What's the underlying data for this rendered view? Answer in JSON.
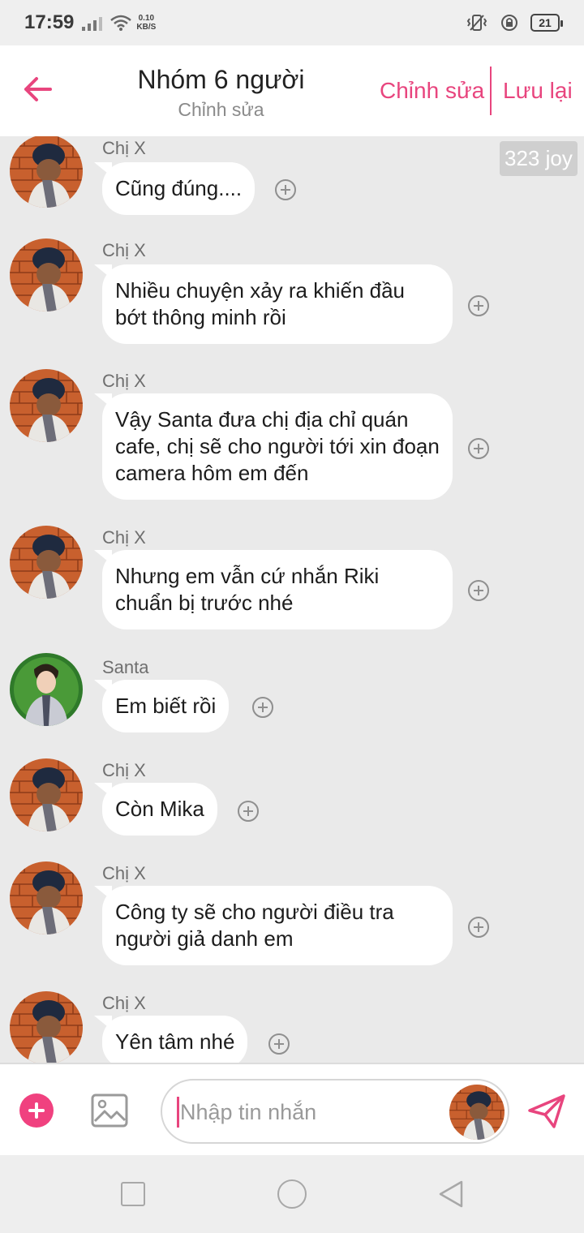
{
  "status_bar": {
    "time": "17:59",
    "net_speed_value": "0.10",
    "net_speed_unit": "KB/S",
    "battery": "21"
  },
  "header": {
    "back_icon": "arrow-left-icon",
    "title": "Nhóm 6 người",
    "subtitle": "Chỉnh sửa",
    "edit_label": "Chỉnh sửa",
    "save_label": "Lưu lại"
  },
  "overlay": {
    "badge": "323 joy"
  },
  "messages": [
    {
      "sender": "Chị X",
      "text": "Cũng đúng...."
    },
    {
      "sender": "Chị X",
      "text": "Nhiều chuyện xảy ra khiến đầu bớt thông minh rồi"
    },
    {
      "sender": "Chị X",
      "text": "Vậy Santa đưa chị địa chỉ quán cafe, chị sẽ cho người  tới xin đoạn camera hôm em đến"
    },
    {
      "sender": "Chị X",
      "text": "Nhưng em vẫn cứ nhắn Riki chuẩn bị trước nhé"
    },
    {
      "sender": "Santa",
      "text": "Em biết rồi"
    },
    {
      "sender": "Chị X",
      "text": "Còn Mika"
    },
    {
      "sender": "Chị X",
      "text": "Công ty sẽ cho người điều tra người giả danh em"
    },
    {
      "sender": "Chị X",
      "text": "Yên tâm nhé"
    }
  ],
  "composer": {
    "placeholder": "Nhập tin nhắn",
    "value": ""
  },
  "colors": {
    "accent": "#e8457e",
    "chat_background": "#eaeaea",
    "bubble": "#ffffff"
  }
}
